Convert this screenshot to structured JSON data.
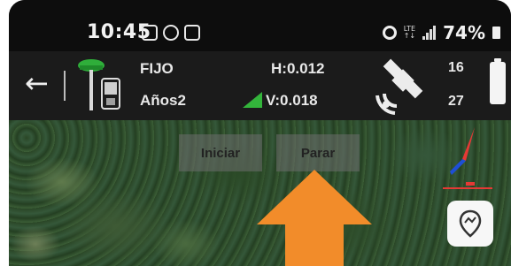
{
  "status_bar": {
    "time": "10:45",
    "battery": "74%",
    "left_icons": [
      "instagram-icon",
      "pinwheel-icon",
      "instagram-icon"
    ],
    "right_icons": [
      "alarm-icon",
      "lte-icon",
      "signal-icon",
      "battery-icon"
    ]
  },
  "toolbar": {
    "back_icon": "back-arrow-icon",
    "mode_label": "FIJO",
    "antenna_label": "Años2",
    "h_precision": "H:0.012",
    "v_precision": "V:0.018",
    "satellites_tracked": "16",
    "satellites_used": "27",
    "colors": {
      "antenna": "#2fae3a",
      "signal": "#33b53b"
    }
  },
  "map": {
    "start_button": "Iniciar",
    "stop_button": "Parar",
    "locate_icon": "location-pin-icon",
    "compass_icon": "compass-icon",
    "annotation_arrow_color": "#f28c2a"
  }
}
